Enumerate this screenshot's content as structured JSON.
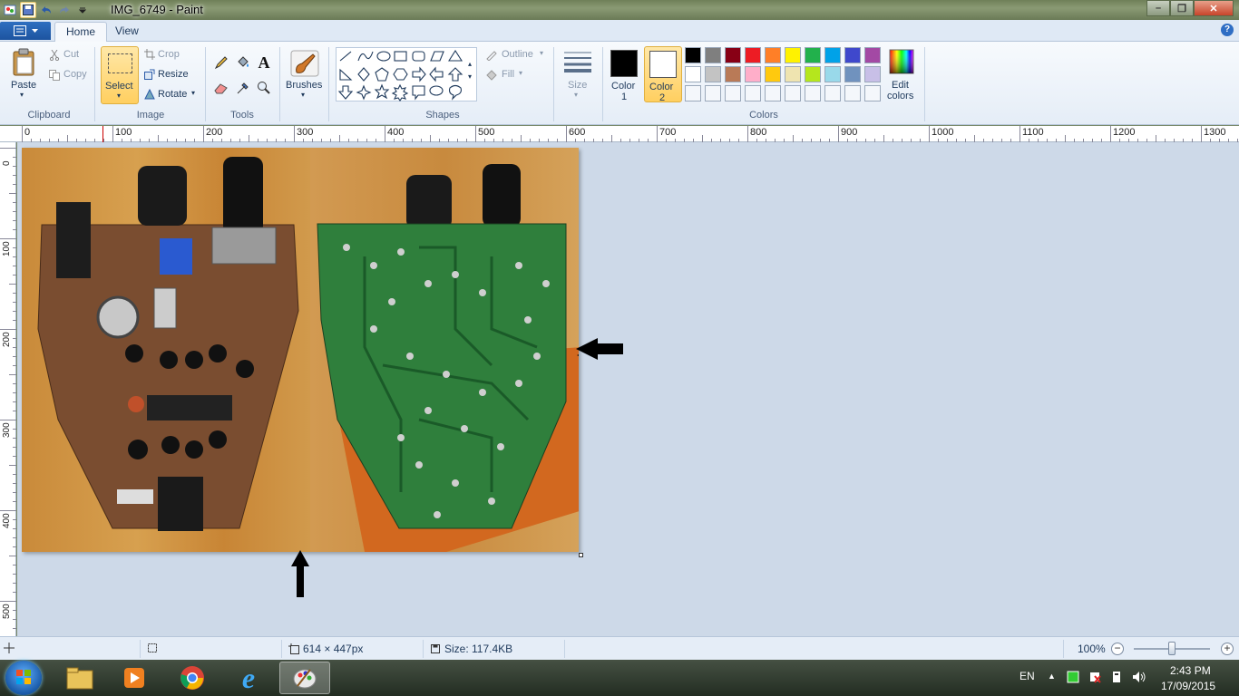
{
  "window": {
    "title": "IMG_6749 - Paint"
  },
  "tabs": [
    {
      "label": "Home",
      "active": true
    },
    {
      "label": "View",
      "active": false
    }
  ],
  "clipboard": {
    "paste": "Paste",
    "cut": "Cut",
    "copy": "Copy",
    "group": "Clipboard"
  },
  "image_group": {
    "select": "Select",
    "crop": "Crop",
    "resize": "Resize",
    "rotate": "Rotate",
    "group": "Image"
  },
  "tools": {
    "group": "Tools"
  },
  "brushes": {
    "label": "Brushes"
  },
  "shapes": {
    "outline": "Outline",
    "fill": "Fill",
    "group": "Shapes"
  },
  "size": {
    "label": "Size"
  },
  "colors": {
    "color1_label_a": "Color",
    "color1_label_b": "1",
    "color2_label_a": "Color",
    "color2_label_b": "2",
    "edit_a": "Edit",
    "edit_b": "colors",
    "group": "Colors",
    "color1": "#000000",
    "color2": "#ffffff",
    "palette_row1": [
      "#000000",
      "#7f7f7f",
      "#880015",
      "#ed1c24",
      "#ff7f27",
      "#fff200",
      "#22b14c",
      "#00a2e8",
      "#3f48cc",
      "#a349a4"
    ],
    "palette_row2": [
      "#ffffff",
      "#c3c3c3",
      "#b97a57",
      "#ffaec9",
      "#ffc90e",
      "#efe4b0",
      "#b5e61d",
      "#99d9ea",
      "#7092be",
      "#c8bfe7"
    ]
  },
  "ruler": {
    "h_labels": [
      "0",
      "100",
      "200",
      "300",
      "400",
      "500",
      "600",
      "700",
      "800",
      "900",
      "1000",
      "1100",
      "1200",
      "1300"
    ],
    "v_labels": [
      "0",
      "100",
      "200",
      "300",
      "400",
      "500"
    ]
  },
  "status": {
    "dimensions": "614 × 447px",
    "size": "Size: 117.4KB",
    "zoom": "100%"
  },
  "taskbar": {
    "lang": "EN",
    "time": "2:43 PM",
    "date": "17/09/2015"
  }
}
